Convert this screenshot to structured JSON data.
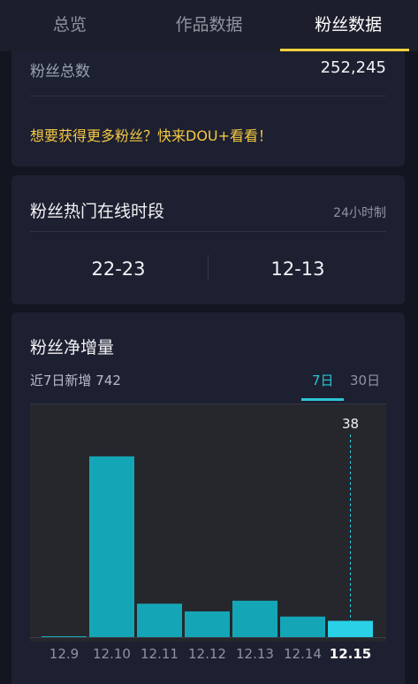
{
  "tabs": [
    {
      "label": "总览",
      "active": false
    },
    {
      "label": "作品数据",
      "active": false
    },
    {
      "label": "粉丝数据",
      "active": true
    }
  ],
  "fans_total": {
    "label": "粉丝总数",
    "value": "252,245"
  },
  "promo_text": "想要获得更多粉丝？快来DOU+看看！",
  "online_hours": {
    "title": "粉丝热门在线时段",
    "note": "24小时制",
    "slots": [
      "22-23",
      "12-13"
    ]
  },
  "net_growth": {
    "title": "粉丝净增量",
    "summary": "近7日新增 742",
    "ranges": [
      "7日",
      "30日"
    ],
    "selected_range": "7日"
  },
  "colors": {
    "accent_tab": "#f4d03f",
    "bar": "#14a6b6",
    "bar_selected": "#2ad0e6",
    "promo": "#f5c842"
  },
  "chart_data": {
    "type": "bar",
    "categories": [
      "12.9",
      "12.10",
      "12.11",
      "12.12",
      "12.13",
      "12.14",
      "12.15"
    ],
    "values": [
      0,
      422,
      78,
      60,
      85,
      48,
      38
    ],
    "selected_index": 6,
    "selected_label": "38",
    "ylim": [
      0,
      440
    ],
    "grid": false
  }
}
